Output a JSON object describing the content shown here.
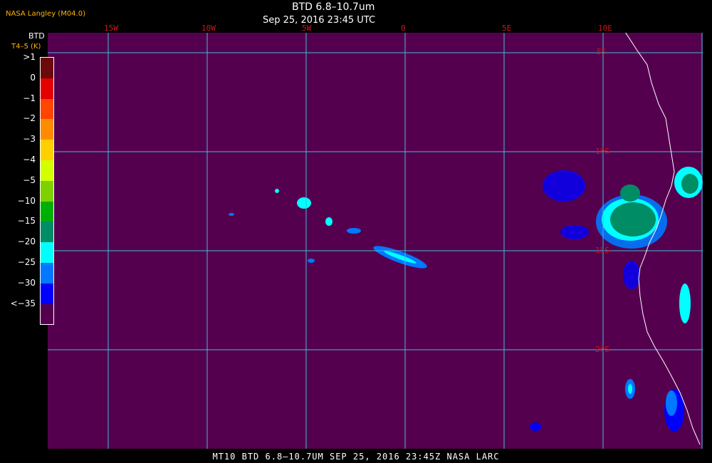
{
  "header": {
    "producer": "NASA Langley (M04.0)",
    "product_title": "BTD 6.8–10.7um",
    "datetime": "Sep 25, 2016 23:45 UTC"
  },
  "legend": {
    "title": "BTD",
    "unit": "T4–5 (K)",
    "entries": [
      {
        "label": ">1",
        "color": "#6a0a0a"
      },
      {
        "label": "0",
        "color": "#e50000"
      },
      {
        "label": "−1",
        "color": "#ff4500"
      },
      {
        "label": "−2",
        "color": "#ff8c00"
      },
      {
        "label": "−3",
        "color": "#ffd000"
      },
      {
        "label": "−4",
        "color": "#d4ff00"
      },
      {
        "label": "−5",
        "color": "#7fd000"
      },
      {
        "label": "−10",
        "color": "#00b000"
      },
      {
        "label": "−15",
        "color": "#008c64"
      },
      {
        "label": "−20",
        "color": "#00ffff"
      },
      {
        "label": "−25",
        "color": "#0078ff"
      },
      {
        "label": "−30",
        "color": "#0000ff"
      },
      {
        "label": "<−35",
        "color": "#55004f"
      }
    ]
  },
  "map": {
    "background_color": "#55004f",
    "grid_color": "#3fbcd9",
    "coastline_color": "#ffffff",
    "label_color": "#d21414",
    "lon_labels": [
      "15W",
      "10W",
      "5W",
      "0",
      "5E",
      "10E"
    ],
    "lat_labels": [
      "5S",
      "10S",
      "15S",
      "20S"
    ]
  },
  "footer": {
    "text": "MT10  BTD 6.8–10.7UM  SEP 25, 2016 23:45Z  NASA LARC"
  }
}
